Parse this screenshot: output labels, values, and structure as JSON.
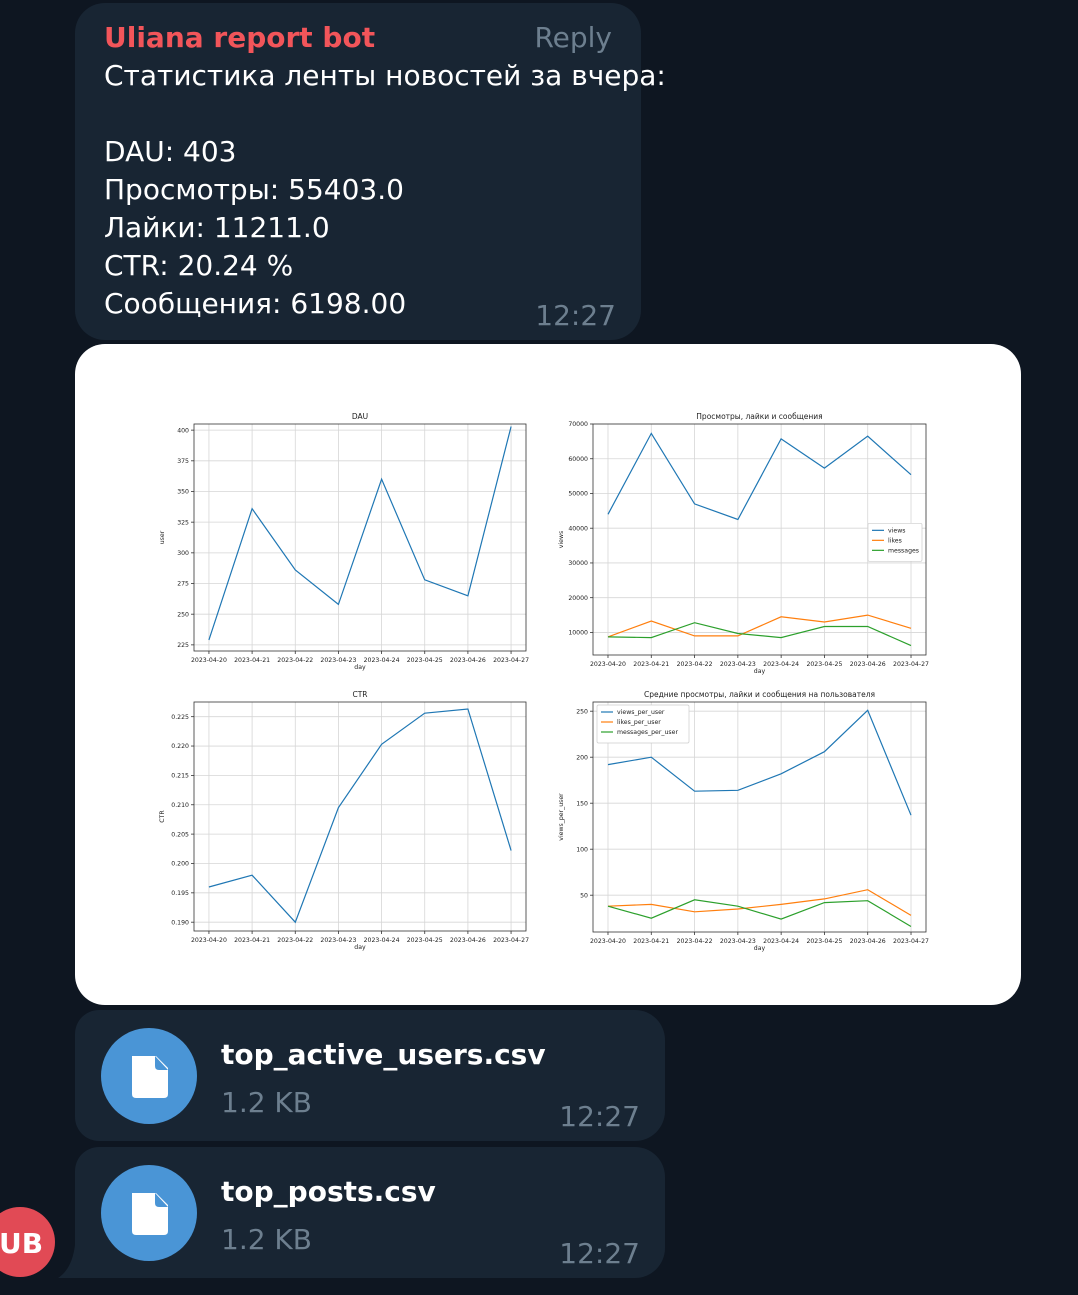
{
  "message": {
    "sender": "Uliana report bot",
    "reply_label": "Reply",
    "lines": [
      "Статистика ленты новостей за вчера:",
      "DAU: 403",
      "Просмотры: 55403.0",
      "Лайки: 11211.0",
      "CTR: 20.24 %",
      "Сообщения: 6198.00"
    ],
    "time": "12:27"
  },
  "files": [
    {
      "name": "top_active_users.csv",
      "size": "1.2 KB",
      "time": "12:27",
      "icon": "file-icon"
    },
    {
      "name": "top_posts.csv",
      "size": "1.2 KB",
      "time": "12:27",
      "icon": "file-icon"
    }
  ],
  "avatar": {
    "initials": "UB",
    "color": "#e14a55"
  },
  "colors": {
    "background": "#0e1621",
    "bubble": "#182533",
    "sender": "#f2555a",
    "muted": "#6d7f8f",
    "file_icon": "#4a95d6"
  },
  "chart_data": [
    {
      "type": "line",
      "title": "DAU",
      "xlabel": "day",
      "ylabel": "user",
      "x": [
        "2023-04-20",
        "2023-04-21",
        "2023-04-22",
        "2023-04-23",
        "2023-04-24",
        "2023-04-25",
        "2023-04-26",
        "2023-04-27"
      ],
      "ylim": [
        220,
        405
      ],
      "yticks": [
        225,
        250,
        275,
        300,
        325,
        350,
        375,
        400
      ],
      "ytick_labels": [
        "225",
        "250",
        "275",
        "300",
        "325",
        "350",
        "375",
        "400"
      ],
      "series": [
        {
          "values": [
            229,
            336,
            286,
            258,
            360,
            278,
            265,
            403
          ],
          "color": "#1f77b4"
        }
      ],
      "grid": true
    },
    {
      "type": "line",
      "title": "Просмотры, лайки и сообщения",
      "xlabel": "day",
      "ylabel": "views",
      "x": [
        "2023-04-20",
        "2023-04-21",
        "2023-04-22",
        "2023-04-23",
        "2023-04-24",
        "2023-04-25",
        "2023-04-26",
        "2023-04-27"
      ],
      "ylim": [
        3500,
        70000
      ],
      "yticks": [
        10000,
        20000,
        30000,
        40000,
        50000,
        60000,
        70000
      ],
      "ytick_labels": [
        "10000",
        "20000",
        "30000",
        "40000",
        "50000",
        "60000",
        "70000"
      ],
      "legend": "center-right",
      "series": [
        {
          "name": "views",
          "values": [
            44000,
            67300,
            47000,
            42500,
            65700,
            57300,
            66500,
            55400
          ],
          "color": "#1f77b4"
        },
        {
          "name": "likes",
          "values": [
            8700,
            13300,
            9000,
            9000,
            14500,
            13000,
            15000,
            11200
          ],
          "color": "#ff7f0e"
        },
        {
          "name": "messages",
          "values": [
            8700,
            8500,
            12800,
            9700,
            8500,
            11700,
            11700,
            6200
          ],
          "color": "#2ca02c"
        }
      ],
      "grid": true
    },
    {
      "type": "line",
      "title": "CTR",
      "xlabel": "day",
      "ylabel": "CTR",
      "x": [
        "2023-04-20",
        "2023-04-21",
        "2023-04-22",
        "2023-04-23",
        "2023-04-24",
        "2023-04-25",
        "2023-04-26",
        "2023-04-27"
      ],
      "ylim": [
        0.1885,
        0.2275
      ],
      "yticks": [
        0.19,
        0.195,
        0.2,
        0.205,
        0.21,
        0.215,
        0.22,
        0.225
      ],
      "ytick_labels": [
        "0.190",
        "0.195",
        "0.200",
        "0.205",
        "0.210",
        "0.215",
        "0.220",
        "0.225"
      ],
      "series": [
        {
          "values": [
            0.196,
            0.198,
            0.19,
            0.2095,
            0.2203,
            0.2256,
            0.2263,
            0.2022
          ],
          "color": "#1f77b4"
        }
      ],
      "grid": true
    },
    {
      "type": "line",
      "title": "Средние просмотры, лайки и сообщения на пользователя",
      "xlabel": "day",
      "ylabel": "views_per_user",
      "x": [
        "2023-04-20",
        "2023-04-21",
        "2023-04-22",
        "2023-04-23",
        "2023-04-24",
        "2023-04-25",
        "2023-04-26",
        "2023-04-27"
      ],
      "ylim": [
        10,
        260
      ],
      "yticks": [
        50,
        100,
        150,
        200,
        250
      ],
      "ytick_labels": [
        "50",
        "100",
        "150",
        "200",
        "250"
      ],
      "legend": "top-left",
      "series": [
        {
          "name": "views_per_user",
          "values": [
            192,
            200,
            163,
            164,
            182,
            206,
            251,
            137
          ],
          "color": "#1f77b4"
        },
        {
          "name": "likes_per_user",
          "values": [
            38,
            40,
            32,
            35,
            40,
            46,
            56,
            28
          ],
          "color": "#ff7f0e"
        },
        {
          "name": "messages_per_user",
          "values": [
            38,
            25,
            45,
            38,
            24,
            42,
            44,
            16
          ],
          "color": "#2ca02c"
        }
      ],
      "grid": true
    }
  ]
}
